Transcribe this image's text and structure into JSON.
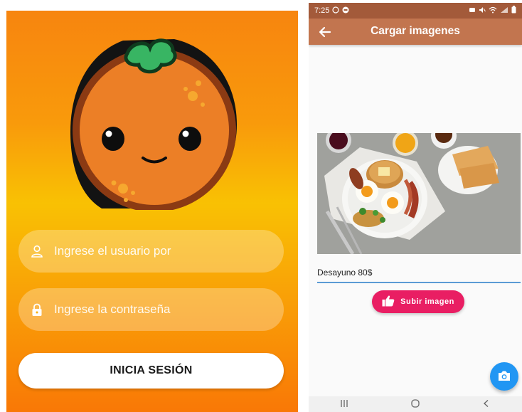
{
  "login": {
    "username_placeholder": "Ingrese el usuario por",
    "password_placeholder": "Ingrese la contraseña",
    "login_label": "INICIA SESIÓN"
  },
  "upload": {
    "status_time": "7:25",
    "title": "Cargar imagenes",
    "description_value": "Desayuno 80$",
    "upload_label": "Subir imagen"
  },
  "icons": {
    "user": "person-outline-icon",
    "password": "lock-icon",
    "back": "arrow-left-icon",
    "upload": "thumb-up-icon",
    "fab": "camera-icon",
    "nav_recents": "recents-icon",
    "nav_home": "home-icon",
    "nav_back": "chevron-left-icon"
  },
  "colors": {
    "accent_upload": "#e91e63",
    "fab": "#2196f3",
    "appbar": "#c2754f",
    "login_gradient_top": "#f7850f",
    "login_gradient_mid": "#f9c103"
  }
}
